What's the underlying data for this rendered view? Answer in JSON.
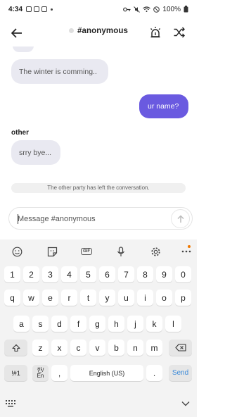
{
  "status_bar": {
    "time": "4:34",
    "battery": "100%"
  },
  "header": {
    "title": "#anonymous"
  },
  "messages": [
    {
      "side": "in",
      "text": "The winter is comming.."
    },
    {
      "side": "out",
      "text": "ur name?"
    },
    {
      "side": "in",
      "sender": "other",
      "text": "srry bye..."
    }
  ],
  "notice": "The other party has left the conversation.",
  "composer": {
    "placeholder": "Message #anonymous"
  },
  "keyboard": {
    "toolbar": [
      "emoji-icon",
      "sticker-icon",
      "gif-icon",
      "mic-icon",
      "settings-icon",
      "more-icon"
    ],
    "gif_label": "GIF",
    "rows": [
      [
        "1",
        "2",
        "3",
        "4",
        "5",
        "6",
        "7",
        "8",
        "9",
        "0"
      ],
      [
        "q",
        "w",
        "e",
        "r",
        "t",
        "y",
        "u",
        "i",
        "o",
        "p"
      ],
      [
        "a",
        "s",
        "d",
        "f",
        "g",
        "h",
        "j",
        "k",
        "l"
      ],
      [
        "z",
        "x",
        "c",
        "v",
        "b",
        "n",
        "m"
      ]
    ],
    "symbols_label": "!#1",
    "lang_top": "한/",
    "lang_bottom": "En",
    "comma_label": ",",
    "space_label": "English (US)",
    "period_label": ".",
    "send_label": "Send"
  }
}
